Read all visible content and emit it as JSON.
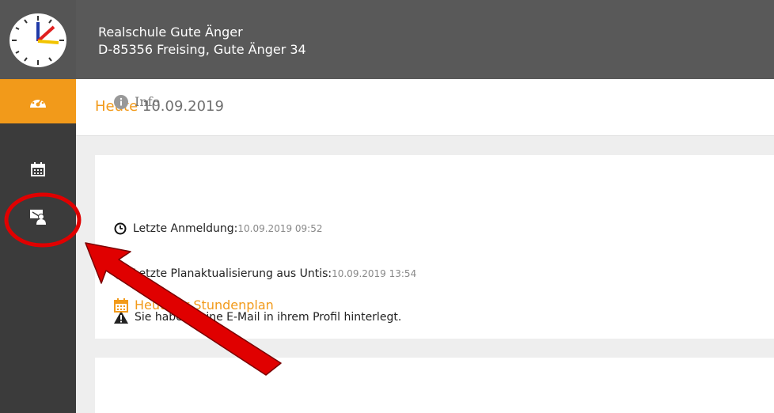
{
  "header": {
    "school_name": "Realschule Gute Änger",
    "school_address": "D-85356 Freising, Gute Änger 34"
  },
  "sidebar": {
    "items": [
      {
        "icon": "dashboard-icon",
        "active": true
      },
      {
        "icon": "calendar-icon",
        "active": false
      },
      {
        "icon": "teacher-board-icon",
        "active": false
      }
    ]
  },
  "page": {
    "title_accent": "Heute",
    "title_date": "10.09.2019"
  },
  "info": {
    "heading": "Info",
    "rows": [
      {
        "icon": "clock-icon",
        "label": "Letzte Anmeldung:",
        "value": "10.09.2019 09:52"
      },
      {
        "icon": "clock-icon",
        "label": "Letzte Planaktualisierung aus Untis:",
        "value": "10.09.2019 13:54"
      },
      {
        "icon": "warning-icon",
        "label": "Sie haben keine E-Mail in ihrem Profil hinterlegt.",
        "value": ""
      }
    ]
  },
  "plan": {
    "heading": "Heutiger Stundenplan"
  },
  "colors": {
    "accent": "#f29a1a",
    "header_bg": "#595959",
    "sidebar_bg": "#3b3b3b",
    "annotation_red": "#e00000"
  }
}
